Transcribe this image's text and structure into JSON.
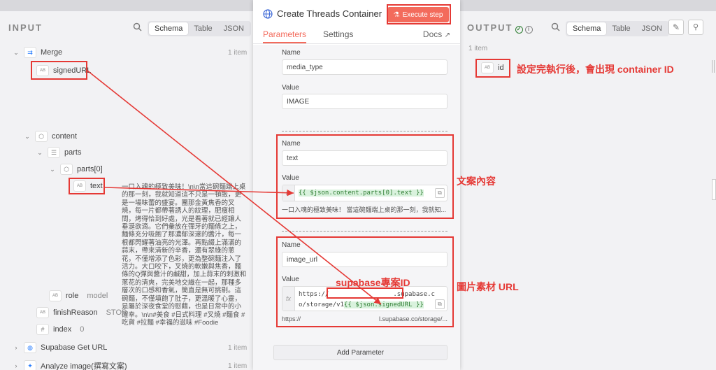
{
  "input": {
    "title": "INPUT",
    "view_tabs": [
      "Schema",
      "Table",
      "JSON"
    ],
    "tree": {
      "merge": {
        "label": "Merge",
        "count": "1 item"
      },
      "signed_url": {
        "key": "signedURL",
        "type_badge": "AB"
      },
      "content": {
        "key": "content"
      },
      "parts": {
        "key": "parts"
      },
      "parts0": {
        "key": "parts[0]"
      },
      "text": {
        "key": "text",
        "type_badge": "AB",
        "value": "一口入魂的極致美味！\\n\\n當這碗麵端上桌的那一刻，我就知道這不只是一頓飯，更是一場味蕾的盛宴。團那金黃焦香的叉燒，每一片都帶著誘人的紋理，肥瘦相間，烤得恰到好處，光是看著就已經讓人垂涎欲滴。它們彙放在彈牙的麵條之上，麵條充分吸飽了那濃郁深邃的醬汁，每一根都閃耀著油亮的光澤。再點綴上滿滿的蒜末，帶來清新的辛香，還有翠綠的蔥花，不僅增添了色彩，更為整碗麵注入了活力。大口咬下，叉燒的軟嫩與焦香，麵條的Q彈與醬汁的鹹甜，加上蒜末的刺激和蔥花的清爽，完美地交織在一起，那種多層次的口感和香氣，簡直是無可挑剔。這碗麵，不僅填飽了肚子，更溫暖了心靈，是屬於深夜食堂的慰藉，也是日常中的小確幸。\\n\\n#美食 #日式料理 #叉燒 #麵食 #吃貨 #拉麵 #幸福的滋味 #Foodie"
      },
      "role": {
        "key": "role",
        "type_badge": "AB",
        "value": "model"
      },
      "finish_reason": {
        "key": "finishReason",
        "type_badge": "AB",
        "value": "STOP"
      },
      "index": {
        "key": "index",
        "type_badge": "#",
        "value": "0"
      },
      "supabase": {
        "label": "Supabase Get URL",
        "count": "1 item"
      },
      "analyze": {
        "label": "Analyze image(撰寫文案)",
        "count": "1 item"
      }
    }
  },
  "modal": {
    "title": "Create Threads Container",
    "execute_label": "Execute step",
    "tabs": [
      "Parameters",
      "Settings"
    ],
    "docs_label": "Docs",
    "params": [
      {
        "name_label": "Name",
        "name": "media_type",
        "value_label": "Value",
        "value": "IMAGE"
      },
      {
        "name_label": "Name",
        "name": "text",
        "value_label": "Value",
        "expr": "{{ $json.content.parts[0].text }}",
        "preview": "一口入魂的極致美味！ 當這碗麵端上桌的那一刻，我就知..."
      },
      {
        "name_label": "Name",
        "name": "image_url",
        "value_label": "Value",
        "expr_prefix": "https://",
        "expr_mid": ".supabase.c",
        "expr_line2": "o/storage/v1",
        "expr_highlight": "{{ $json.signedURL }}",
        "preview_left": "https://",
        "preview_right": "l.supabase.co/storage/..."
      }
    ],
    "fx_label": "fx",
    "add_param_label": "Add Parameter"
  },
  "output": {
    "title": "OUTPUT",
    "view_tabs": [
      "Schema",
      "Table",
      "JSON"
    ],
    "count": "1 item",
    "id_key": "id",
    "id_badge": "AB"
  },
  "annotations": {
    "container_id": "設定完執行後，會出現 container ID",
    "caption_content": "文案內容",
    "supabase_id": "supabase專案ID",
    "image_url": "圖片素材 URL"
  },
  "colors": {
    "accent": "#f36b5c",
    "annotation_red": "#e53935",
    "highlight_green": "#d9f2dd"
  },
  "icons": [
    "search-icon",
    "merge-icon",
    "globe-icon",
    "flask-icon",
    "external-link-icon",
    "pencil-icon",
    "pin-icon",
    "check-circle-icon",
    "info-icon",
    "drag-handle-icon"
  ]
}
